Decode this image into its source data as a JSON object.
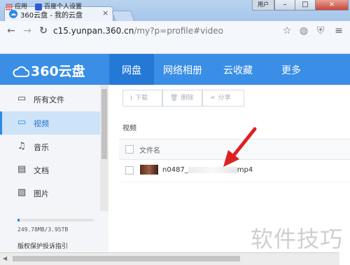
{
  "browser": {
    "tab_title": "360云盘 - 我的云盘",
    "tab_close": "×",
    "user_button": "用户",
    "url_host": "c15.yunpan.360.cn",
    "url_path": "/my?p=profile#video",
    "bookmarks": [
      {
        "label": "应用",
        "icon": "apps-grid-icon"
      },
      {
        "label": "百度个人设置",
        "icon": "baidu-paw-icon"
      }
    ]
  },
  "app": {
    "logo": "360云盘",
    "nav": [
      {
        "label": "网盘",
        "active": true
      },
      {
        "label": "网络相册",
        "active": false
      },
      {
        "label": "云收藏",
        "active": false
      },
      {
        "label": "更多",
        "active": false
      }
    ],
    "accent": "#3a8ee6"
  },
  "sidebar": {
    "items": [
      {
        "label": "所有文件",
        "icon": "folder-icon"
      },
      {
        "label": "视频",
        "icon": "video-icon",
        "active": true
      },
      {
        "label": "音乐",
        "icon": "music-icon"
      },
      {
        "label": "文档",
        "icon": "document-icon"
      },
      {
        "label": "图片",
        "icon": "image-icon"
      }
    ],
    "quota": "249.78MB/3.95TB",
    "footer_link": "版权保护投诉指引"
  },
  "toolbar": {
    "download": "下载",
    "delete": "删除",
    "share": "分享"
  },
  "content": {
    "breadcrumb": "视频",
    "column_filename": "文件名",
    "file_prefix": "n0487_",
    "file_suffix": "mp4"
  },
  "watermark": "软件技巧"
}
